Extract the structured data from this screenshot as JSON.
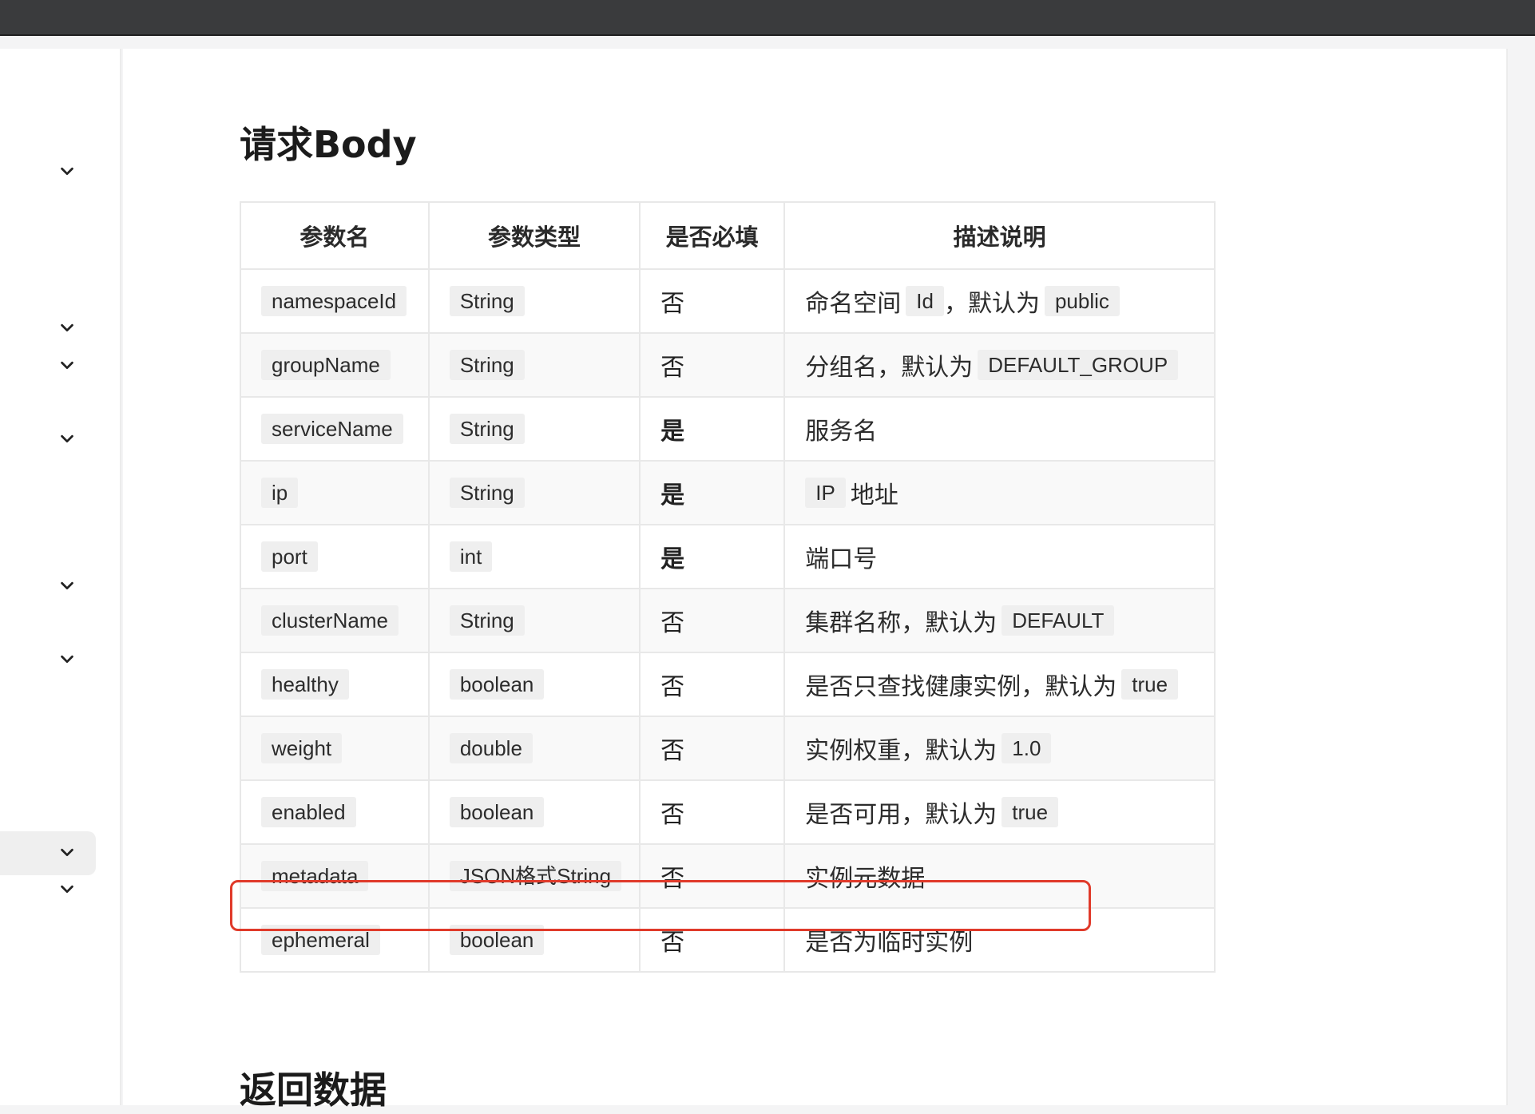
{
  "colors": {
    "topbar": "#3a3b3d",
    "highlight": "#e03a2a",
    "code_bg": "#efefef"
  },
  "sidebar": {
    "expand_icons": [
      "chevron-down-icon",
      "chevron-down-icon",
      "chevron-down-icon",
      "chevron-down-icon",
      "chevron-down-icon",
      "chevron-down-icon",
      "chevron-down-icon",
      "chevron-down-icon"
    ]
  },
  "section1": {
    "title": "请求Body"
  },
  "table": {
    "headers": [
      "参数名",
      "参数类型",
      "是否必填",
      "描述说明"
    ],
    "rows": [
      {
        "name": "namespaceId",
        "type": "String",
        "required": "否",
        "desc": [
          {
            "t": "命名空间"
          },
          {
            "c": "Id"
          },
          {
            "t": "，默认为"
          },
          {
            "c": "public"
          }
        ]
      },
      {
        "name": "groupName",
        "type": "String",
        "required": "否",
        "desc": [
          {
            "t": "分组名，默认为"
          },
          {
            "c": "DEFAULT_GROUP"
          }
        ]
      },
      {
        "name": "serviceName",
        "type": "String",
        "required": "是",
        "desc": [
          {
            "t": "服务名"
          }
        ]
      },
      {
        "name": "ip",
        "type": "String",
        "required": "是",
        "desc": [
          {
            "c": "IP"
          },
          {
            "t": "地址"
          }
        ]
      },
      {
        "name": "port",
        "type": "int",
        "required": "是",
        "desc": [
          {
            "t": "端口号"
          }
        ]
      },
      {
        "name": "clusterName",
        "type": "String",
        "required": "否",
        "desc": [
          {
            "t": "集群名称，默认为"
          },
          {
            "c": "DEFAULT"
          }
        ]
      },
      {
        "name": "healthy",
        "type": "boolean",
        "required": "否",
        "desc": [
          {
            "t": "是否只查找健康实例，默认为"
          },
          {
            "c": "true"
          }
        ]
      },
      {
        "name": "weight",
        "type": "double",
        "required": "否",
        "desc": [
          {
            "t": "实例权重，默认为"
          },
          {
            "c": "1.0"
          }
        ]
      },
      {
        "name": "enabled",
        "type": "boolean",
        "required": "否",
        "desc": [
          {
            "t": "是否可用，默认为"
          },
          {
            "c": "true"
          }
        ]
      },
      {
        "name": "metadata",
        "type": "JSON格式String",
        "required": "否",
        "desc": [
          {
            "t": "实例元数据"
          }
        ]
      },
      {
        "name": "ephemeral",
        "type": "boolean",
        "required": "否",
        "desc": [
          {
            "t": "是否为临时实例"
          }
        ]
      }
    ]
  },
  "section2": {
    "title": "返回数据"
  }
}
